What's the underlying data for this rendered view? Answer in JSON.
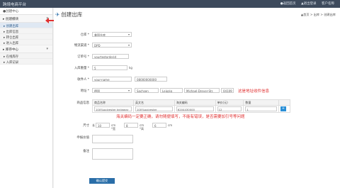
{
  "topbar": {
    "brand": "跨境电商平台",
    "links": [
      "●返回首页",
      "▲退出登录",
      "客户名称"
    ]
  },
  "sidebar": {
    "head": "●创建中心",
    "groups": [
      {
        "label": "▸ 创建模块",
        "items": [
          "▸ 创建出库",
          "▸ 出库信息",
          "▸ 转仓出库",
          "▸ 进入出库"
        ]
      },
      {
        "label": "▸ 库存中心",
        "items": [
          "▸ 在线库存",
          "▸ 入库记录"
        ]
      }
    ]
  },
  "main": {
    "title": "创建出库",
    "breadcrumb": "▲首页 > 出库 > 创建出库",
    "fields": {
      "warehouse_label": "仓库 *",
      "warehouse_value": "美国仓库",
      "carrier_label": "物流渠道 *",
      "carrier_value": "DPD",
      "order_label": "订单号 *",
      "order_value": "yourtestorderid",
      "weight_label": "入库重量 *",
      "weight_value": "5",
      "weight_unit": "kg",
      "contact_label": "收件人 *",
      "contact_name": "your-name",
      "contact_phone": "08000000000",
      "address_label": "地址 *",
      "country": "德国",
      "state": "Sachsen",
      "city": "Leipzig",
      "street": "Michael-Dreyer-Str.",
      "zip": "04109",
      "address_note": "这是地址收件信息",
      "goods_label": "商品信息",
      "sizes_label": "尺寸",
      "length": "10",
      "width": "8",
      "height": "6",
      "dim_unit_l": "cm *宽",
      "dim_unit_w": "cm *高",
      "dim_unit_h": "cm",
      "declared_label": "申报价值",
      "remark_label": "备注",
      "submit_label": "确认提交"
    },
    "table": {
      "headers": [
        "商品名称",
        "英文名",
        "海关编码",
        "单价(元)",
        "数量"
      ],
      "row": [
        "100%polyester knitwear",
        "100%polyester",
        "6204430000",
        "12",
        "1"
      ]
    },
    "note_red": "海关编码一定要正确，请勿随便填写，不能有错误，是否需要加引号等问题"
  }
}
